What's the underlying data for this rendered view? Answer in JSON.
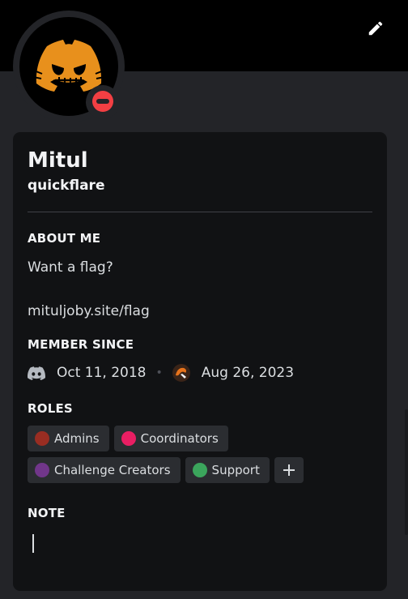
{
  "profile": {
    "display_name": "Mitul",
    "username": "quickflare",
    "status": "dnd",
    "avatar_icon": "discord-logo-pumpkin-icon",
    "colors": {
      "banner": "#000000",
      "avatar_face": "#e8901c",
      "status_dnd": "#f23f43"
    }
  },
  "about": {
    "heading": "ABOUT ME",
    "text": "Want a flag?\n\nmituljoby.site/flag"
  },
  "member_since": {
    "heading": "MEMBER SINCE",
    "discord_icon": "discord-icon",
    "discord_date": "Oct 11, 2018",
    "separator": "•",
    "server_icon": "server-avatar-icon",
    "server_date": "Aug 26, 2023"
  },
  "roles": {
    "heading": "ROLES",
    "items": [
      {
        "name": "Admins",
        "color": "#992d22"
      },
      {
        "name": "Coordinators",
        "color": "#e91e63"
      },
      {
        "name": "Challenge Creators",
        "color": "#71368a"
      },
      {
        "name": "Support",
        "color": "#3ba55c"
      }
    ],
    "add_icon": "plus-icon"
  },
  "note": {
    "heading": "NOTE",
    "value": ""
  },
  "toolbar": {
    "edit_icon": "pencil-icon"
  }
}
